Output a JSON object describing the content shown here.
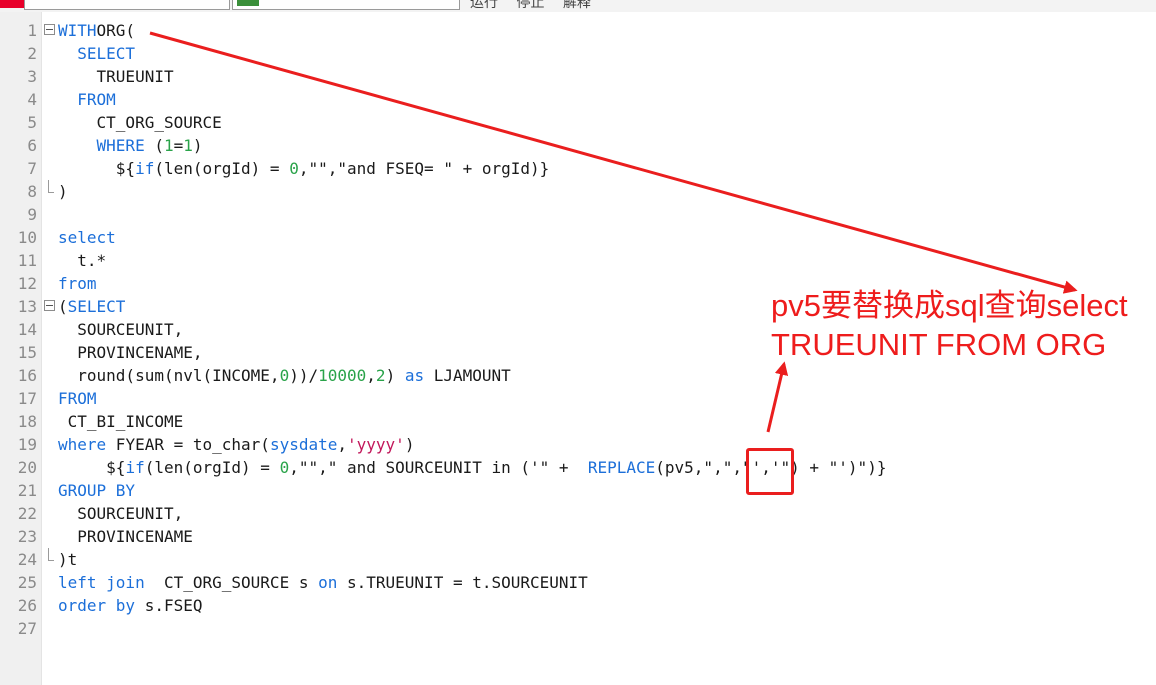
{
  "toolbar": {
    "run_label": "运行",
    "stop_label": "停止",
    "explain_label": "解释"
  },
  "editor": {
    "lines": [
      {
        "n": "1",
        "fold": "box",
        "tokens": [
          [
            "kw",
            "WITH"
          ],
          [
            "",
            "ORG("
          ]
        ]
      },
      {
        "n": "2",
        "fold": "",
        "tokens": [
          [
            "",
            "  "
          ],
          [
            "kw",
            "SELECT"
          ]
        ]
      },
      {
        "n": "3",
        "fold": "",
        "tokens": [
          [
            "",
            "    TRUEUNIT"
          ]
        ]
      },
      {
        "n": "4",
        "fold": "",
        "tokens": [
          [
            "",
            "  "
          ],
          [
            "kw",
            "FROM"
          ]
        ]
      },
      {
        "n": "5",
        "fold": "",
        "tokens": [
          [
            "",
            "    CT_ORG_SOURCE"
          ]
        ]
      },
      {
        "n": "6",
        "fold": "",
        "tokens": [
          [
            "",
            "    "
          ],
          [
            "kw",
            "WHERE"
          ],
          [
            "",
            " ("
          ],
          [
            "num",
            "1"
          ],
          [
            "",
            "="
          ],
          [
            "num",
            "1"
          ],
          [
            "",
            ")"
          ]
        ]
      },
      {
        "n": "7",
        "fold": "",
        "tokens": [
          [
            "",
            "      ${"
          ],
          [
            "kw",
            "if"
          ],
          [
            "",
            "(len(orgId) = "
          ],
          [
            "num",
            "0"
          ],
          [
            "",
            ",\"\",\"and FSEQ= \" + orgId)}"
          ]
        ]
      },
      {
        "n": "8",
        "fold": "end",
        "tokens": [
          [
            "",
            ")"
          ]
        ]
      },
      {
        "n": "9",
        "fold": "",
        "tokens": []
      },
      {
        "n": "10",
        "fold": "",
        "tokens": [
          [
            "kw",
            "select"
          ]
        ]
      },
      {
        "n": "11",
        "fold": "",
        "tokens": [
          [
            "",
            "  t.*"
          ]
        ]
      },
      {
        "n": "12",
        "fold": "",
        "tokens": [
          [
            "kw",
            "from"
          ]
        ]
      },
      {
        "n": "13",
        "fold": "box",
        "tokens": [
          [
            "",
            "("
          ],
          [
            "kw",
            "SELECT"
          ]
        ]
      },
      {
        "n": "14",
        "fold": "",
        "tokens": [
          [
            "",
            "  SOURCEUNIT,"
          ]
        ]
      },
      {
        "n": "15",
        "fold": "",
        "tokens": [
          [
            "",
            "  PROVINCENAME,"
          ]
        ]
      },
      {
        "n": "16",
        "fold": "",
        "tokens": [
          [
            "",
            "  round(sum(nvl(INCOME,"
          ],
          [
            "num",
            "0"
          ],
          [
            "",
            "))/"
          ],
          [
            "num",
            "10000"
          ],
          [
            "",
            ","
          ],
          [
            "num",
            "2"
          ],
          [
            "",
            ") "
          ],
          [
            "kw",
            "as"
          ],
          [
            "",
            " LJAMOUNT"
          ]
        ]
      },
      {
        "n": "17",
        "fold": "",
        "tokens": [
          [
            "kw",
            "FROM"
          ]
        ]
      },
      {
        "n": "18",
        "fold": "",
        "tokens": [
          [
            "",
            " CT_BI_INCOME"
          ]
        ]
      },
      {
        "n": "19",
        "fold": "",
        "tokens": [
          [
            "kw",
            "where"
          ],
          [
            "",
            " FYEAR = to_char("
          ],
          [
            "kw",
            "sysdate"
          ],
          [
            "",
            ","
          ],
          [
            "str",
            "'yyyy'"
          ],
          [
            "",
            ")"
          ]
        ]
      },
      {
        "n": "20",
        "fold": "",
        "tokens": [
          [
            "",
            "     ${"
          ],
          [
            "kw",
            "if"
          ],
          [
            "",
            "(len(orgId) = "
          ],
          [
            "num",
            "0"
          ],
          [
            "",
            ",\"\",\" and SOURCEUNIT in ('\" +  "
          ],
          [
            "fn",
            "REPLACE"
          ],
          [
            "",
            "(pv5,\",\",\"','\") + \"')\")}"
          ]
        ]
      },
      {
        "n": "21",
        "fold": "",
        "tokens": [
          [
            "kw",
            "GROUP BY"
          ]
        ]
      },
      {
        "n": "22",
        "fold": "",
        "tokens": [
          [
            "",
            "  SOURCEUNIT,"
          ]
        ]
      },
      {
        "n": "23",
        "fold": "",
        "tokens": [
          [
            "",
            "  PROVINCENAME"
          ]
        ]
      },
      {
        "n": "24",
        "fold": "end",
        "tokens": [
          [
            "",
            ")t"
          ]
        ]
      },
      {
        "n": "25",
        "fold": "",
        "tokens": [
          [
            "kw",
            "left join"
          ],
          [
            "",
            "  CT_ORG_SOURCE s "
          ],
          [
            "kw",
            "on"
          ],
          [
            "",
            " s.TRUEUNIT = t.SOURCEUNIT"
          ]
        ]
      },
      {
        "n": "26",
        "fold": "",
        "tokens": [
          [
            "kw",
            "order by"
          ],
          [
            "",
            " s.FSEQ"
          ]
        ]
      },
      {
        "n": "27",
        "fold": "",
        "tokens": []
      }
    ]
  },
  "annotation": {
    "line1": "pv5要替换成sql查询select",
    "line2": "TRUEUNIT FROM ORG",
    "color": "#ee1c1c"
  },
  "colors": {
    "keyword": "#1c6fd9",
    "number": "#2aa34a",
    "string": "#c2185b"
  }
}
